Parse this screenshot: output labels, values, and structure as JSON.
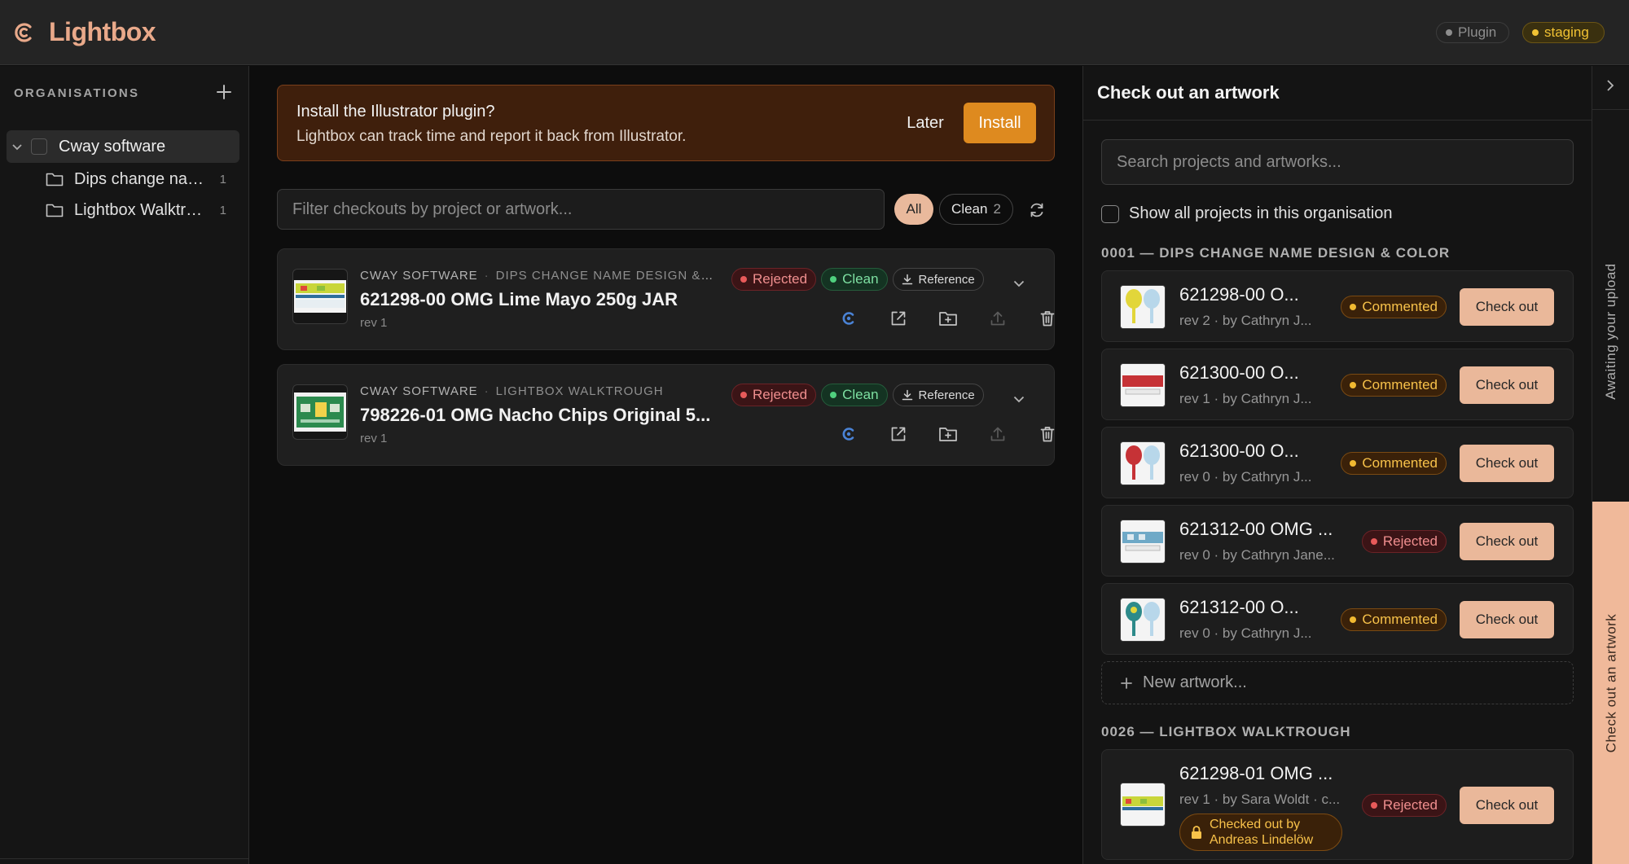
{
  "app": {
    "title": "Lightbox"
  },
  "env": {
    "plugin": "Plugin",
    "staging": "staging"
  },
  "sidebar": {
    "heading": "ORGANISATIONS",
    "org": {
      "name": "Cway software"
    },
    "projects": [
      {
        "name": "Dips change name design & color",
        "count": "1"
      },
      {
        "name": "Lightbox Walktrough",
        "count": "1"
      }
    ]
  },
  "banner": {
    "title": "Install the Illustrator plugin?",
    "text": "Lightbox can track time and report it back from Illustrator.",
    "later": "Later",
    "install": "Install"
  },
  "filter": {
    "placeholder": "Filter checkouts by project or artwork...",
    "all": "All",
    "clean": "Clean",
    "clean_count": "2"
  },
  "checkouts": [
    {
      "org": "CWAY SOFTWARE",
      "project": "DIPS CHANGE NAME DESIGN & C...",
      "title": "621298-00 OMG Lime Mayo 250g JAR",
      "rev": "rev 1",
      "status": "Rejected",
      "state": "Clean",
      "ref": "Reference"
    },
    {
      "org": "CWAY SOFTWARE",
      "project": "LIGHTBOX WALKTROUGH",
      "title": "798226-01 OMG Nacho Chips Original 5...",
      "rev": "rev 1",
      "status": "Rejected",
      "state": "Clean",
      "ref": "Reference"
    }
  ],
  "panel": {
    "title": "Check out an artwork",
    "search_placeholder": "Search projects and artworks...",
    "show_all": "Show all projects in this organisation",
    "group1": "0001 — DIPS CHANGE NAME DESIGN & COLOR",
    "group2": "0026 — LIGHTBOX WALKTROUGH",
    "new_artwork": "New artwork...",
    "checkout_label": "Check out",
    "artworks": [
      {
        "title": "621298-00 O...",
        "sub": "rev 2 · by Cathryn J...",
        "status": "Commented"
      },
      {
        "title": "621300-00 O...",
        "sub": "rev 1 · by Cathryn J...",
        "status": "Commented"
      },
      {
        "title": "621300-00 O...",
        "sub": "rev 0 · by Cathryn J...",
        "status": "Commented"
      },
      {
        "title": "621312-00 OMG ...",
        "sub": "rev 0 · by Cathryn Jane...",
        "status": "Rejected"
      },
      {
        "title": "621312-00 O...",
        "sub": "rev 0 · by Cathryn J...",
        "status": "Commented"
      }
    ],
    "artwork2": {
      "title": "621298-01 OMG ...",
      "sub": "rev 1 · by Sara Woldt · c...",
      "status": "Rejected",
      "lock_line1": "Checked out by",
      "lock_line2": "Andreas Lindelöw"
    }
  },
  "rail": {
    "awaiting": "Awaiting your upload",
    "checkout": "Check out an artwork"
  }
}
